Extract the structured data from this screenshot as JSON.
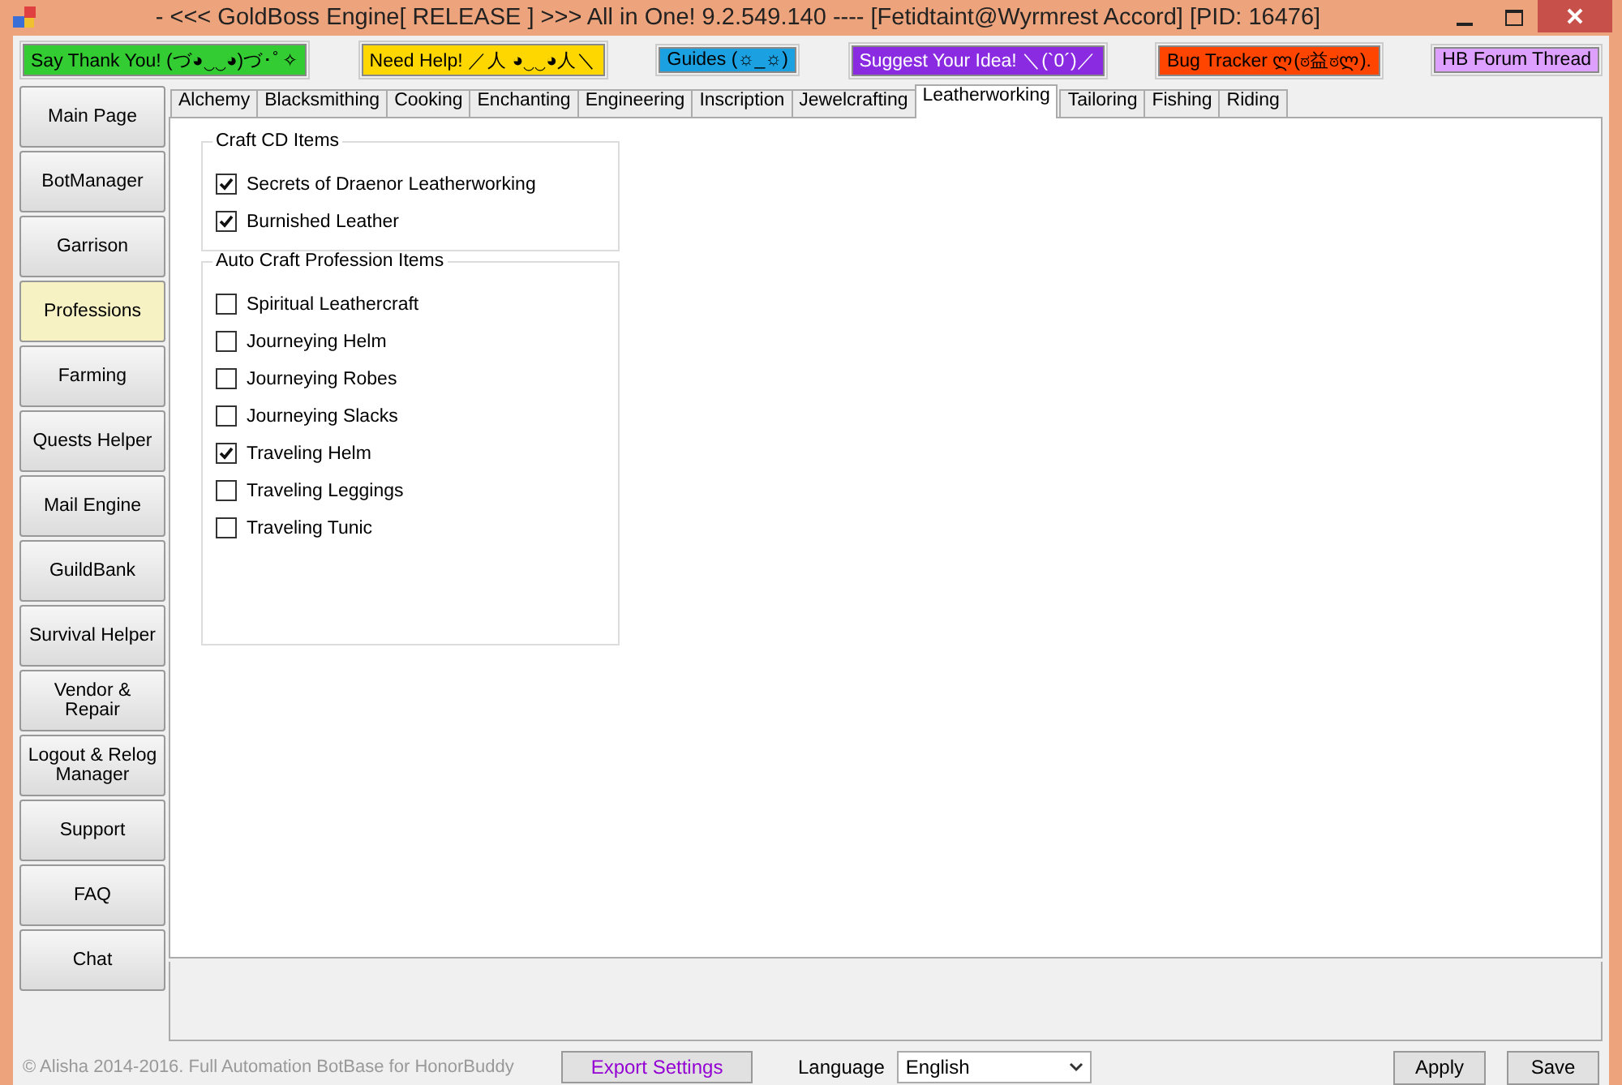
{
  "window": {
    "title": "- <<< GoldBoss Engine[ RELEASE ]  >>>  All in One! 9.2.549.140  ----  [Fetidtaint@Wyrmrest Accord] [PID: 16476]"
  },
  "link_buttons": [
    {
      "label": "Say Thank You! (づ◕‿‿◕)づ･ﾟ✧",
      "color": "#33cc33"
    },
    {
      "label": "Need Help! ／人 ◕‿‿◕人＼",
      "color": "#ffd700"
    },
    {
      "label": "Guides (☼_☼)",
      "color": "#1ba1e2"
    },
    {
      "label": "Suggest Your Idea! ＼(`0´)／",
      "color": "#8a2be2"
    },
    {
      "label": "Bug Tracker ლ(ಠ益ಠლ).",
      "color": "#ff4500"
    },
    {
      "label": "HB Forum Thread",
      "color": "#dda0ff"
    }
  ],
  "nav": [
    {
      "label": "Main Page",
      "selected": false
    },
    {
      "label": "BotManager",
      "selected": false
    },
    {
      "label": "Garrison",
      "selected": false
    },
    {
      "label": "Professions",
      "selected": true
    },
    {
      "label": "Farming",
      "selected": false
    },
    {
      "label": "Quests Helper",
      "selected": false
    },
    {
      "label": "Mail Engine",
      "selected": false
    },
    {
      "label": "GuildBank",
      "selected": false
    },
    {
      "label": "Survival Helper",
      "selected": false
    },
    {
      "label": "Vendor & Repair",
      "selected": false
    },
    {
      "label": "Logout & Relog Manager",
      "selected": false
    },
    {
      "label": "Support",
      "selected": false
    },
    {
      "label": "FAQ",
      "selected": false
    },
    {
      "label": "Chat",
      "selected": false
    }
  ],
  "tabs": [
    {
      "label": "Alchemy",
      "selected": false
    },
    {
      "label": "Blacksmithing",
      "selected": false
    },
    {
      "label": "Cooking",
      "selected": false
    },
    {
      "label": "Enchanting",
      "selected": false
    },
    {
      "label": "Engineering",
      "selected": false
    },
    {
      "label": "Inscription",
      "selected": false
    },
    {
      "label": "Jewelcrafting",
      "selected": false
    },
    {
      "label": "Leatherworking",
      "selected": true
    },
    {
      "label": "Tailoring",
      "selected": false
    },
    {
      "label": "Fishing",
      "selected": false
    },
    {
      "label": "Riding",
      "selected": false
    }
  ],
  "groups": [
    {
      "title": "Craft CD Items",
      "items": [
        {
          "label": "Secrets of Draenor Leatherworking",
          "checked": true
        },
        {
          "label": "Burnished Leather",
          "checked": true
        }
      ]
    },
    {
      "title": "Auto Craft Profession Items",
      "items": [
        {
          "label": "Spiritual Leathercraft",
          "checked": false
        },
        {
          "label": "Journeying Helm",
          "checked": false
        },
        {
          "label": "Journeying Robes",
          "checked": false
        },
        {
          "label": "Journeying Slacks",
          "checked": false
        },
        {
          "label": "Traveling Helm",
          "checked": true
        },
        {
          "label": "Traveling Leggings",
          "checked": false
        },
        {
          "label": "Traveling Tunic",
          "checked": false
        }
      ]
    }
  ],
  "footer": {
    "copyright": "© Alisha 2014-2016. Full Automation BotBase for HonorBuddy",
    "export_button": "Export Settings",
    "language_label": "Language",
    "language_value": "English",
    "buttons": [
      "Apply",
      "Save"
    ]
  }
}
